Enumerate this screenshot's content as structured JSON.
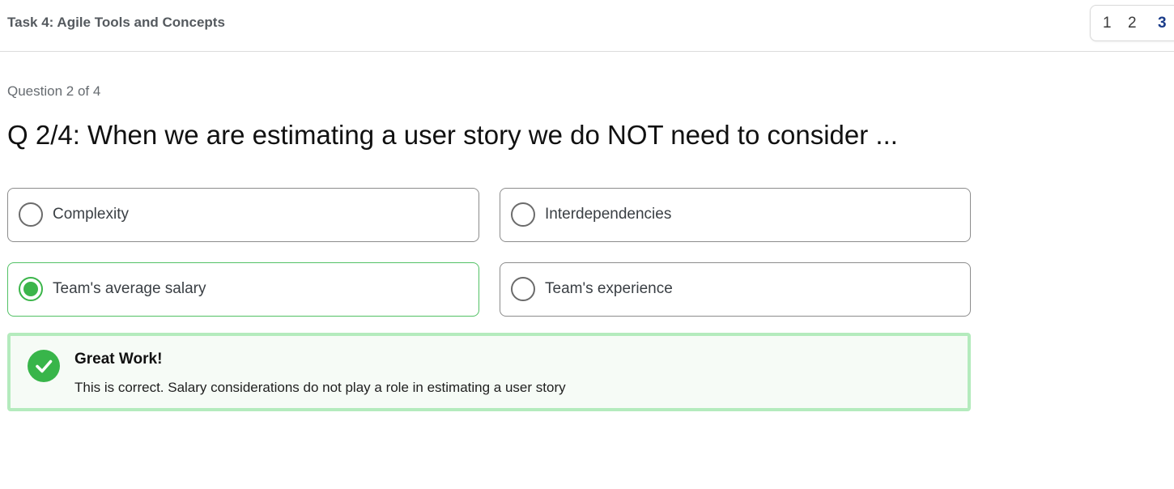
{
  "header": {
    "task_title": "Task 4: Agile Tools and Concepts",
    "pager": [
      "1",
      "2",
      "3"
    ],
    "active_page": "3",
    "active_color": "#1a3c8a"
  },
  "question": {
    "counter": "Question 2 of 4",
    "title": "Q 2/4: When we are estimating a user story we do NOT need to consider ..."
  },
  "options": [
    {
      "label": "Complexity",
      "selected": false
    },
    {
      "label": "Interdependencies",
      "selected": false
    },
    {
      "label": "Team's average salary",
      "selected": true
    },
    {
      "label": "Team's experience",
      "selected": false
    }
  ],
  "feedback": {
    "icon": "check-circle-icon",
    "title": "Great Work!",
    "text": "This is correct. Salary considerations do not play a role in estimating a user story",
    "accent": "#38b54a",
    "border": "#b4ebbd"
  }
}
